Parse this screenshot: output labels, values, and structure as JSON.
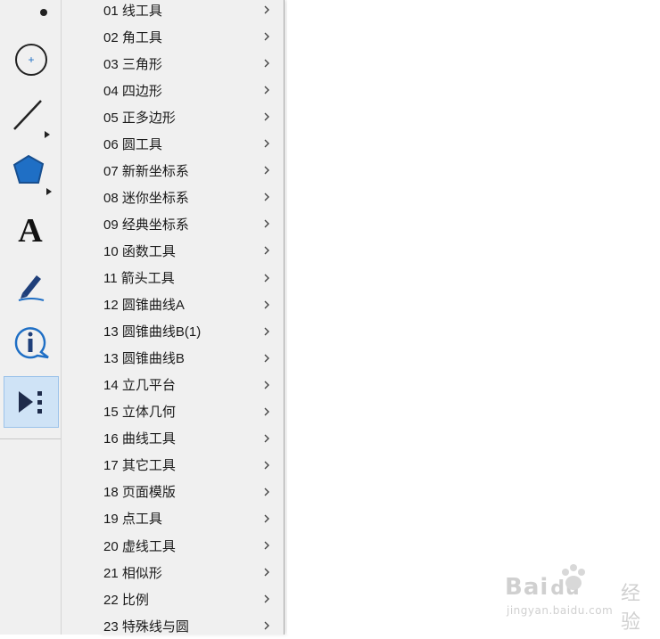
{
  "toolbar": {
    "tools": [
      {
        "name": "point-tool",
        "icon": "point-icon"
      },
      {
        "name": "circle-tool",
        "icon": "circle-icon"
      },
      {
        "name": "line-tool",
        "icon": "line-segment-icon"
      },
      {
        "name": "polygon-tool",
        "icon": "pentagon-icon"
      },
      {
        "name": "text-tool",
        "icon": "text-A-icon",
        "glyph": "A"
      },
      {
        "name": "marker-tool",
        "icon": "marker-pen-icon"
      },
      {
        "name": "info-tool",
        "icon": "info-icon",
        "glyph": "i"
      },
      {
        "name": "custom-tool",
        "icon": "custom-tools-icon",
        "active": true
      }
    ]
  },
  "menu": {
    "items": [
      {
        "label": "01 线工具"
      },
      {
        "label": "02 角工具"
      },
      {
        "label": "03 三角形"
      },
      {
        "label": "04 四边形"
      },
      {
        "label": "05 正多边形"
      },
      {
        "label": "06 圆工具"
      },
      {
        "label": "07 新新坐标系"
      },
      {
        "label": "08 迷你坐标系"
      },
      {
        "label": "09 经典坐标系"
      },
      {
        "label": "10 函数工具"
      },
      {
        "label": "11 箭头工具"
      },
      {
        "label": "12 圆锥曲线A"
      },
      {
        "label": "13 圆锥曲线B(1)"
      },
      {
        "label": "13 圆锥曲线B"
      },
      {
        "label": "14 立几平台"
      },
      {
        "label": "15 立体几何"
      },
      {
        "label": "16 曲线工具"
      },
      {
        "label": "17 其它工具"
      },
      {
        "label": "18 页面模版"
      },
      {
        "label": "19 点工具"
      },
      {
        "label": "20 虚线工具"
      },
      {
        "label": "21 相似形"
      },
      {
        "label": "22 比例"
      },
      {
        "label": "23 特殊线与圆"
      }
    ]
  },
  "watermark": {
    "brand": "Bai",
    "brand2": "du",
    "sub": "经验",
    "url": "jingyan.baidu.com"
  },
  "colors": {
    "accent": "#1f6fc5",
    "toolbar_bg": "#f0f0f0",
    "active_bg": "#cfe3f6"
  }
}
